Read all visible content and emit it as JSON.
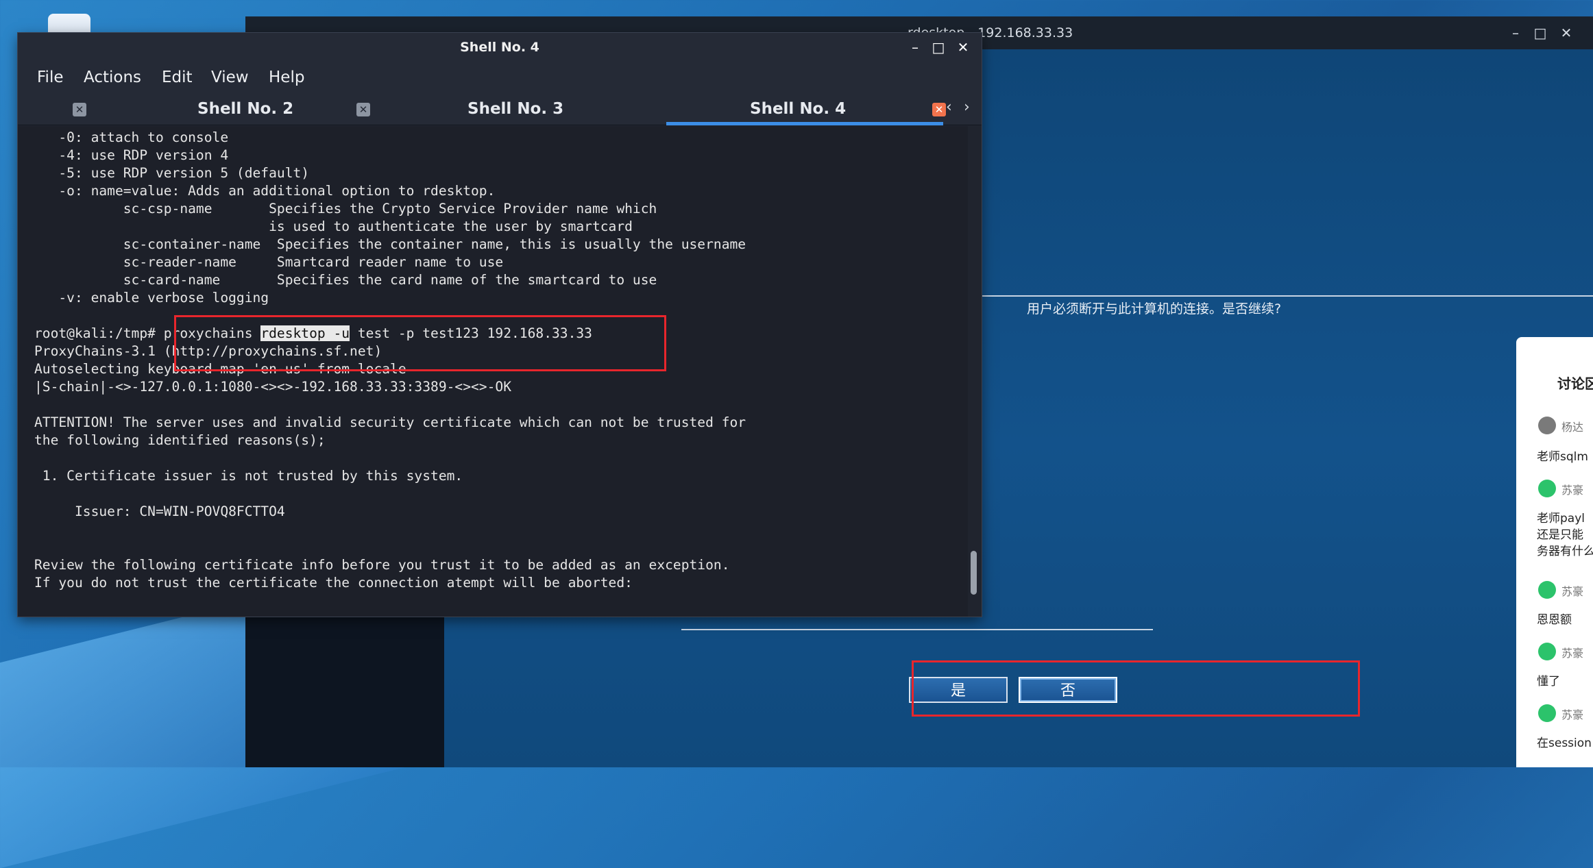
{
  "desktop": {
    "background_color": "#1f6fb4"
  },
  "rdp_window": {
    "title": "rdesktop - 192.168.33.33",
    "buttons": {
      "minimize": "–",
      "maximize": "□",
      "close": "✕"
    },
    "dialog": {
      "message": "用户必须断开与此计算机的连接。是否继续?",
      "yes_label": "是",
      "no_label": "否"
    }
  },
  "chat_panel": {
    "title": "讨论区",
    "messages": [
      {
        "name": "杨达",
        "text": "老师sqlm",
        "avatar": "gray"
      },
      {
        "name": "苏豪",
        "text": "老师payl",
        "text2": "还是只能",
        "text3": "务器有什么",
        "avatar": "green"
      },
      {
        "name": "苏豪",
        "text": "恩恩额",
        "avatar": "green"
      },
      {
        "name": "苏豪",
        "text": "懂了",
        "avatar": "green"
      },
      {
        "name": "苏豪",
        "text": "在session",
        "avatar": "green"
      }
    ]
  },
  "terminal": {
    "title": "Shell No. 4",
    "window_buttons": {
      "minimize": "–",
      "maximize": "□",
      "close": "✕"
    },
    "menu": [
      "File",
      "Actions",
      "Edit",
      "View",
      "Help"
    ],
    "tabs": [
      {
        "label": "Shell No. 2",
        "active": false
      },
      {
        "label": "Shell No. 3",
        "active": false
      },
      {
        "label": "Shell No. 4",
        "active": true
      }
    ],
    "tab_close_glyph": "✕",
    "tab_nav": {
      "prev": "‹",
      "next": "›"
    },
    "lines": [
      "   -0: attach to console",
      "   -4: use RDP version 4",
      "   -5: use RDP version 5 (default)",
      "   -o: name=value: Adds an additional option to rdesktop.",
      "           sc-csp-name       Specifies the Crypto Service Provider name which",
      "                             is used to authenticate the user by smartcard",
      "           sc-container-name  Specifies the container name, this is usually the username",
      "           sc-reader-name     Smartcard reader name to use",
      "           sc-card-name       Specifies the card name of the smartcard to use",
      "   -v: enable verbose logging",
      "",
      "",
      "ProxyChains-3.1 (http://proxychains.sf.net)",
      "Autoselecting keyboard map 'en-us' from locale",
      "|S-chain|-<>-127.0.0.1:1080-<><>-192.168.33.33:3389-<><>-OK",
      "",
      "ATTENTION! The server uses and invalid security certificate which can not be trusted for",
      "the following identified reasons(s);",
      "",
      " 1. Certificate issuer is not trusted by this system.",
      "",
      "     Issuer: CN=WIN-POVQ8FCTTO4",
      "",
      "",
      "Review the following certificate info before you trust it to be added as an exception.",
      "If you do not trust the certificate the connection atempt will be aborted:"
    ],
    "prompt_line": {
      "prompt": "root@kali:/tmp# ",
      "cmd_a": "proxychains ",
      "cmd_selected": "rdesktop -u",
      "cmd_b": " test -p test123 192.168.33.33"
    }
  }
}
